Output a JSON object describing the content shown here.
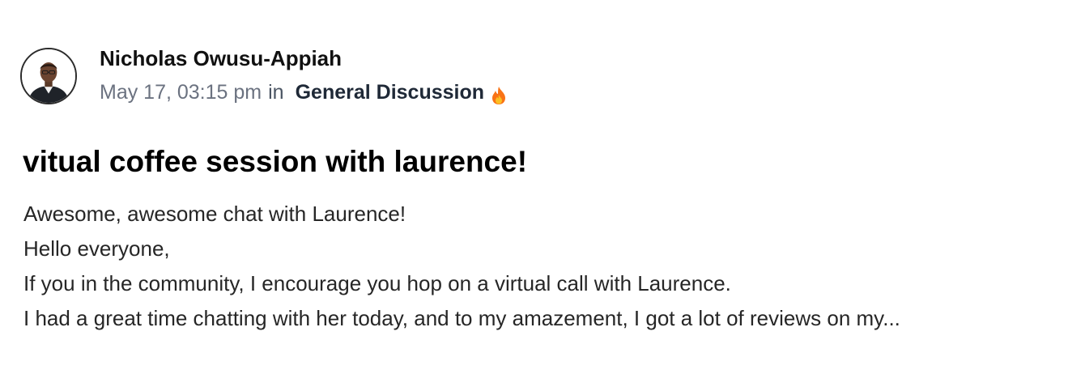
{
  "author": {
    "name": "Nicholas Owusu-Appiah",
    "avatar_icon": "avatar-portrait-icon"
  },
  "meta": {
    "date": "May 17, 03:15 pm",
    "in_label": "in",
    "space_name": "General Discussion",
    "space_icon": "fire-icon"
  },
  "post": {
    "title": "vitual coffee session with laurence!",
    "lines": [
      "Awesome, awesome chat with Laurence!",
      "Hello everyone,",
      "If you in the community, I encourage you hop on a virtual call with Laurence.",
      "I had a great time chatting with her today, and to my amazement, I got a lot of reviews on my..."
    ]
  },
  "colors": {
    "meta_gray": "#6b7280",
    "fire_orange": "#f97316",
    "fire_yellow": "#fbbf24"
  }
}
